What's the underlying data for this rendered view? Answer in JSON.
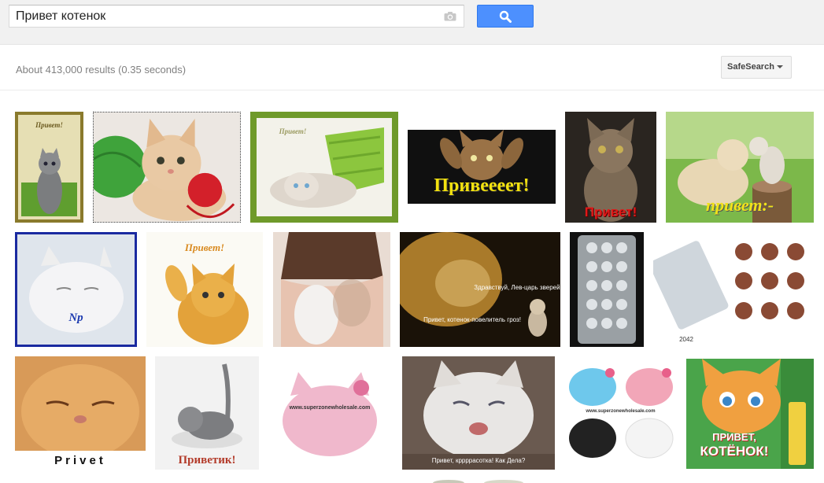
{
  "search": {
    "query": "Привет котенок"
  },
  "results": {
    "stats": "About 413,000 results (0.35 seconds)",
    "safesearch_label": "SafeSearch"
  },
  "images": {
    "captions": {
      "privet_red": "Привет!",
      "priveeet": "Привеееет!",
      "privet_yellow": "привет:-",
      "privet_orange": "Привет!",
      "np": "Np",
      "lion_1": "Здравствуй, Лев-царь зверей!",
      "lion_2": "Привет, котенок-повелитель гроз!",
      "code_2042": "2042",
      "privet_latin": "Privet",
      "privetik": "Приветик!",
      "superzone_1": "www.superzonewholesale.com",
      "superzone_2": "www.superzonewholesale.com",
      "krasotka": "Привет, кррррасотка! Как Дела?",
      "kotenok_book_1": "ПРИВЕТ,",
      "kotenok_book_2": "КОТЁНОК!",
      "privet_top": "Привет!"
    }
  }
}
